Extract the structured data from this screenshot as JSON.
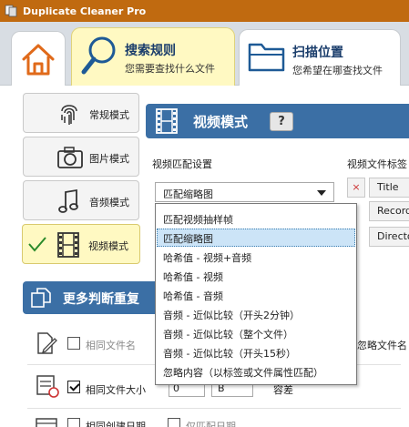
{
  "window": {
    "title": "Duplicate Cleaner Pro"
  },
  "tabs": [
    {
      "id": "home",
      "label": "",
      "subtitle": ""
    },
    {
      "id": "rules",
      "label": "搜索规则",
      "subtitle": "您需要查找什么文件"
    },
    {
      "id": "location",
      "label": "扫描位置",
      "subtitle": "您希望在哪查找文件"
    }
  ],
  "modes": [
    {
      "label": "常规模式",
      "icon": "fingerprint-icon",
      "selected": false
    },
    {
      "label": "图片模式",
      "icon": "camera-icon",
      "selected": false
    },
    {
      "label": "音频模式",
      "icon": "music-note-icon",
      "selected": false
    },
    {
      "label": "视频模式",
      "icon": "film-icon",
      "selected": true
    }
  ],
  "video_panel": {
    "title": "视频模式",
    "help_label": "?",
    "match_settings_label": "视频匹配设置",
    "tag_label": "视频文件标签",
    "match_select": {
      "value": "匹配缩略图",
      "options": [
        "匹配视频抽样帧",
        "匹配缩略图",
        "哈希值 - 视频+音频",
        "哈希值 - 视频",
        "哈希值 - 音频",
        "音频 - 近似比较（开头2分钟）",
        "音频 - 近似比较（整个文件）",
        "音频 - 近似比较（开头15秒）",
        "忽略内容（以标签或文件属性匹配）"
      ],
      "selected_index": 1
    },
    "tags": [
      {
        "remove_label": "×",
        "value": "Title"
      },
      {
        "remove_label": "",
        "value": "Record"
      },
      {
        "remove_label": "",
        "value": "Directo"
      }
    ]
  },
  "more_criteria": {
    "title": "更多判断重复",
    "rows": [
      {
        "label": "相同文件名",
        "checked": false,
        "right_text": "忽略文件名",
        "icon": "file-edit-icon"
      },
      {
        "label": "相同文件大小",
        "checked": true,
        "spin_value": "0",
        "unit": "B",
        "suffix": "容差",
        "icon": "file-size-icon"
      },
      {
        "label": "相同创建日期",
        "checked": false,
        "right_text": "仅匹配日期",
        "icon": "calendar-icon"
      }
    ]
  },
  "colors": {
    "title_bar": "#c06a10",
    "panel_header": "#3b6fa5",
    "selected_tab": "#fff9c2",
    "dropdown_highlight": "#cce4f7"
  }
}
